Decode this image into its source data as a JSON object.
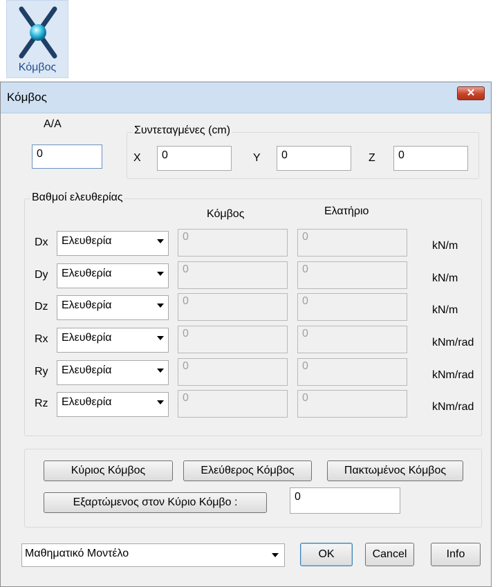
{
  "ribbon": {
    "label": "Κόμβος"
  },
  "dialog": {
    "title": "Κόμβος",
    "close_symbol": "✕",
    "aa": {
      "label": "Α/Α",
      "value": "0"
    },
    "coords": {
      "legend": "Συντεταγμένες (cm)",
      "x_label": "X",
      "x_value": "0",
      "y_label": "Y",
      "y_value": "0",
      "z_label": "Z",
      "z_value": "0"
    },
    "dof": {
      "legend": "Βαθμοί ελευθερίας",
      "col_node": "Κόμβος",
      "col_spring": "Ελατήριο",
      "rows": [
        {
          "label": "Dx",
          "option": "Ελευθερία",
          "node": "0",
          "spring": "0",
          "unit": "kN/m"
        },
        {
          "label": "Dy",
          "option": "Ελευθερία",
          "node": "0",
          "spring": "0",
          "unit": "kN/m"
        },
        {
          "label": "Dz",
          "option": "Ελευθερία",
          "node": "0",
          "spring": "0",
          "unit": "kN/m"
        },
        {
          "label": "Rx",
          "option": "Ελευθερία",
          "node": "0",
          "spring": "0",
          "unit": "kNm/rad"
        },
        {
          "label": "Ry",
          "option": "Ελευθερία",
          "node": "0",
          "spring": "0",
          "unit": "kNm/rad"
        },
        {
          "label": "Rz",
          "option": "Ελευθερία",
          "node": "0",
          "spring": "0",
          "unit": "kNm/rad"
        }
      ]
    },
    "presets": {
      "main_node": "Κύριος Κόμβος",
      "free_node": "Ελεύθερος Κόμβος",
      "fixed_node": "Πακτωμένος Κόμβος",
      "dependent": "Εξαρτώμενος στον Κύριο Κόμβο :",
      "dependent_value": "0"
    },
    "model_select": "Μαθηματικό Μοντέλο",
    "ok": "OK",
    "cancel": "Cancel",
    "info": "Info"
  }
}
